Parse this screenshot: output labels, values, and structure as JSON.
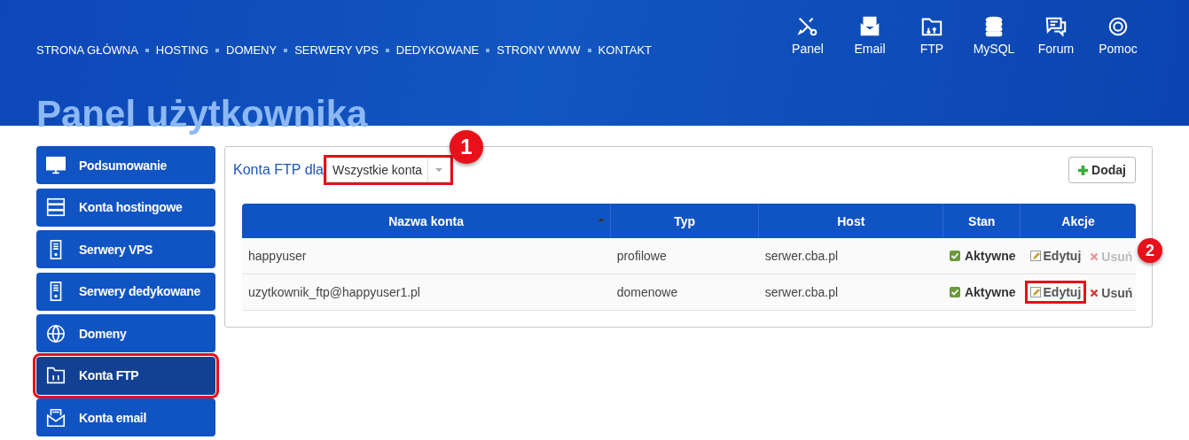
{
  "top_nav": [
    "STRONA GŁÓWNA",
    "HOSTING",
    "DOMENY",
    "SERWERY VPS",
    "DEDYKOWANE",
    "STRONY WWW",
    "KONTAKT"
  ],
  "quick_links": [
    "Panel",
    "Email",
    "FTP",
    "MySQL",
    "Forum",
    "Pomoc"
  ],
  "page_title": "Panel użytkownika",
  "sidebar": {
    "items": [
      {
        "label": "Podsumowanie",
        "selected": false,
        "highlighted": false
      },
      {
        "label": "Konta hostingowe",
        "selected": false,
        "highlighted": false
      },
      {
        "label": "Serwery VPS",
        "selected": false,
        "highlighted": false
      },
      {
        "label": "Serwery dedykowane",
        "selected": false,
        "highlighted": false
      },
      {
        "label": "Domeny",
        "selected": false,
        "highlighted": false
      },
      {
        "label": "Konta FTP",
        "selected": true,
        "highlighted": true
      },
      {
        "label": "Konta email",
        "selected": false,
        "highlighted": false
      }
    ]
  },
  "panel": {
    "filter_label": "Konta FTP dla",
    "filter": {
      "value": "Wszystkie konta",
      "highlighted": true,
      "badge": "1"
    },
    "add_button": "Dodaj",
    "table": {
      "columns": [
        "Nazwa konta",
        "Typ",
        "Host",
        "Stan",
        "Akcje"
      ],
      "rows": [
        {
          "name": "happyuser",
          "type": "profilowe",
          "host": "serwer.cba.pl",
          "status": "Aktywne",
          "edit": "Edytuj",
          "edit_highlighted": false,
          "delete": "Usuń",
          "delete_disabled": true,
          "badge": "2"
        },
        {
          "name": "uzytkownik_ftp@happyuser1.pl",
          "type": "domenowe",
          "host": "serwer.cba.pl",
          "status": "Aktywne",
          "edit": "Edytuj",
          "edit_highlighted": true,
          "delete": "Usuń",
          "delete_disabled": false
        }
      ]
    }
  }
}
